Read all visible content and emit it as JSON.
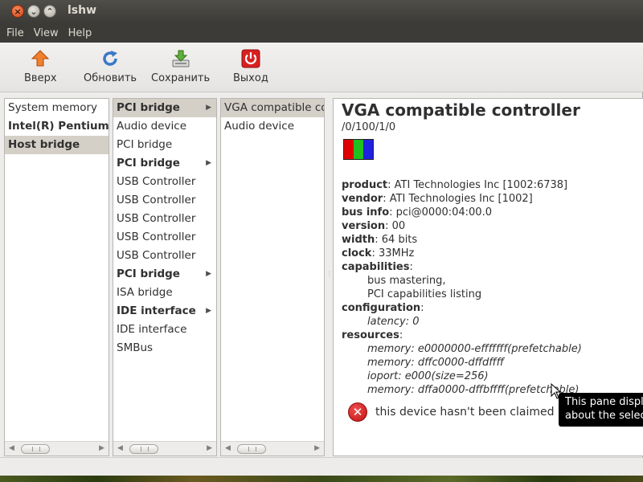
{
  "window": {
    "title": "lshw"
  },
  "menu": [
    {
      "label": "File"
    },
    {
      "label": "View"
    },
    {
      "label": "Help"
    }
  ],
  "toolbar": {
    "up_label": "Вверх",
    "refresh_label": "Обновить",
    "save_label": "Сохранить",
    "quit_label": "Выход"
  },
  "col1": [
    {
      "label": "System memory",
      "bold": false,
      "selected": false,
      "arrow": false
    },
    {
      "label": "Intel(R) Pentium(R)",
      "bold": true,
      "selected": false,
      "arrow": false
    },
    {
      "label": "Host bridge",
      "bold": true,
      "selected": true,
      "arrow": false
    }
  ],
  "col2": [
    {
      "label": "PCI bridge",
      "bold": true,
      "selected": true,
      "arrow": true
    },
    {
      "label": "Audio device",
      "bold": false,
      "selected": false,
      "arrow": false
    },
    {
      "label": "PCI bridge",
      "bold": false,
      "selected": false,
      "arrow": false
    },
    {
      "label": "PCI bridge",
      "bold": true,
      "selected": false,
      "arrow": true
    },
    {
      "label": "USB Controller",
      "bold": false,
      "selected": false,
      "arrow": false
    },
    {
      "label": "USB Controller",
      "bold": false,
      "selected": false,
      "arrow": false
    },
    {
      "label": "USB Controller",
      "bold": false,
      "selected": false,
      "arrow": false
    },
    {
      "label": "USB Controller",
      "bold": false,
      "selected": false,
      "arrow": false
    },
    {
      "label": "USB Controller",
      "bold": false,
      "selected": false,
      "arrow": false
    },
    {
      "label": "PCI bridge",
      "bold": true,
      "selected": false,
      "arrow": true
    },
    {
      "label": "ISA bridge",
      "bold": false,
      "selected": false,
      "arrow": false
    },
    {
      "label": "IDE interface",
      "bold": true,
      "selected": false,
      "arrow": true
    },
    {
      "label": "IDE interface",
      "bold": false,
      "selected": false,
      "arrow": false
    },
    {
      "label": "SMBus",
      "bold": false,
      "selected": false,
      "arrow": false
    }
  ],
  "col3": [
    {
      "label": "VGA compatible controller",
      "bold": false,
      "selected": true,
      "arrow": false
    },
    {
      "label": "Audio device",
      "bold": false,
      "selected": false,
      "arrow": false
    }
  ],
  "detail": {
    "title": "VGA compatible controller",
    "path": "/0/100/1/0",
    "icon": "display-adapter-icon",
    "icon_colors": [
      "#e00000",
      "#20c020",
      "#2020e0"
    ],
    "props": [
      {
        "key": "product",
        "value": "ATI Technologies Inc [1002:6738]"
      },
      {
        "key": "vendor",
        "value": "ATI Technologies Inc [1002]"
      },
      {
        "key": "bus info",
        "value": "pci@0000:04:00.0"
      },
      {
        "key": "version",
        "value": "00"
      },
      {
        "key": "width",
        "value": "64 bits"
      },
      {
        "key": "clock",
        "value": "33MHz"
      }
    ],
    "capabilities_label": "capabilities",
    "capabilities": [
      "bus mastering,",
      "PCI capabilities listing"
    ],
    "configuration_label": "configuration",
    "configuration": [
      "latency: 0"
    ],
    "resources_label": "resources",
    "resources": [
      "memory: e0000000-efffffff(prefetchable)",
      "memory: dffc0000-dffdffff",
      "ioport: e000(size=256)",
      "memory: dffa0000-dffbffff(prefetchable)"
    ],
    "claim_status": "this device hasn't been claimed"
  },
  "tooltip": {
    "line1": "This pane displays information",
    "line2": "about the selected hardware node"
  }
}
